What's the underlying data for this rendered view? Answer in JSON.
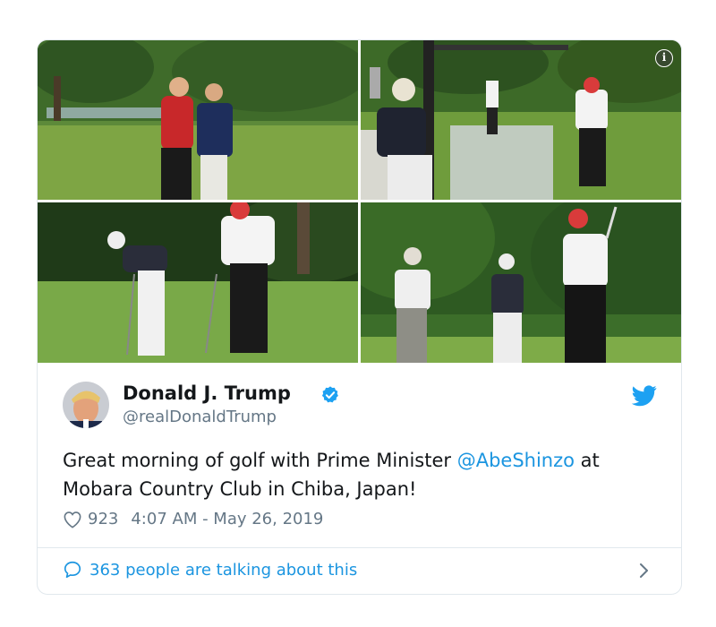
{
  "tweet": {
    "author_name": "Donald J. Trump",
    "author_handle": "@realDonaldTrump",
    "text_before": "Great morning of golf with Prime Minister ",
    "mention": "@AbeShinzo",
    "text_after": " at Mobara Country Club in Chiba, Japan!",
    "likes": "923",
    "timestamp": "4:07 AM - May 26, 2019",
    "conversation_label": "363 people are talking about this",
    "info_label": "i"
  },
  "colors": {
    "brand_blue": "#1da1f2",
    "link_blue": "#1b95e0",
    "secondary_text": "#657786",
    "divider": "#e1e8ed"
  },
  "icons": {
    "verified": "verified-badge-icon",
    "platform": "twitter-bird-icon",
    "like": "heart-icon",
    "conversation": "speech-bubble-icon",
    "more": "chevron-right-icon",
    "info": "info-icon"
  }
}
